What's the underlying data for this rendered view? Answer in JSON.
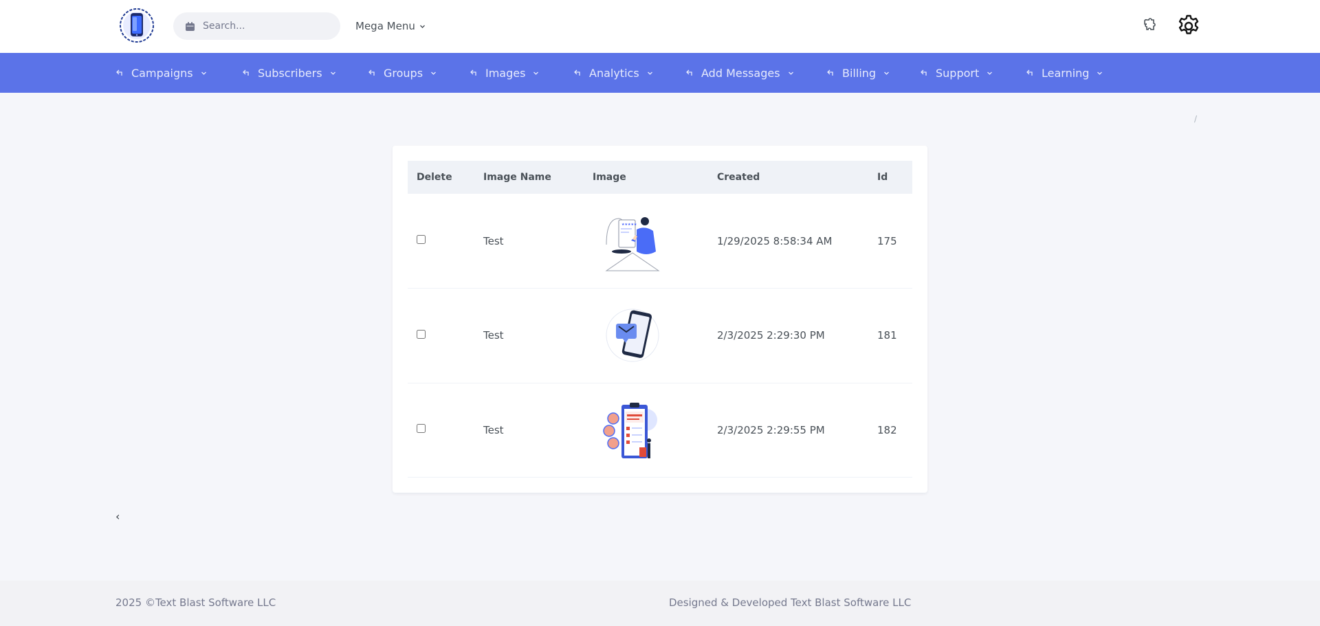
{
  "header": {
    "search_placeholder": "Search...",
    "mega_menu_label": "Mega Menu"
  },
  "nav": {
    "items": [
      {
        "label": "Campaigns"
      },
      {
        "label": "Subscribers"
      },
      {
        "label": "Groups"
      },
      {
        "label": "Images"
      },
      {
        "label": "Analytics"
      },
      {
        "label": "Add Messages"
      },
      {
        "label": "Billing"
      },
      {
        "label": "Support"
      },
      {
        "label": "Learning"
      }
    ]
  },
  "breadcrumb": {
    "separator": "/"
  },
  "table": {
    "columns": [
      "Delete",
      "Image Name",
      "Image",
      "Created",
      "Id"
    ],
    "rows": [
      {
        "name": "Test",
        "image_icon": "person-reviews-illustration-icon",
        "created": "1/29/2025 8:58:34 AM",
        "id": "175"
      },
      {
        "name": "Test",
        "image_icon": "phone-message-illustration-icon",
        "created": "2/3/2025 2:29:30 PM",
        "id": "181"
      },
      {
        "name": "Test",
        "image_icon": "event-clipboard-illustration-icon",
        "created": "2/3/2025 2:29:55 PM",
        "id": "182"
      }
    ]
  },
  "pagination": {
    "prev_label": "‹"
  },
  "footer": {
    "copyright": "2025 ©Text Blast Software LLC",
    "credit": "Designed & Developed Text Blast Software LLC"
  },
  "colors": {
    "nav_bg": "#5b73e8",
    "page_bg": "#f5f6fa",
    "table_header_bg": "#eff2f7"
  }
}
